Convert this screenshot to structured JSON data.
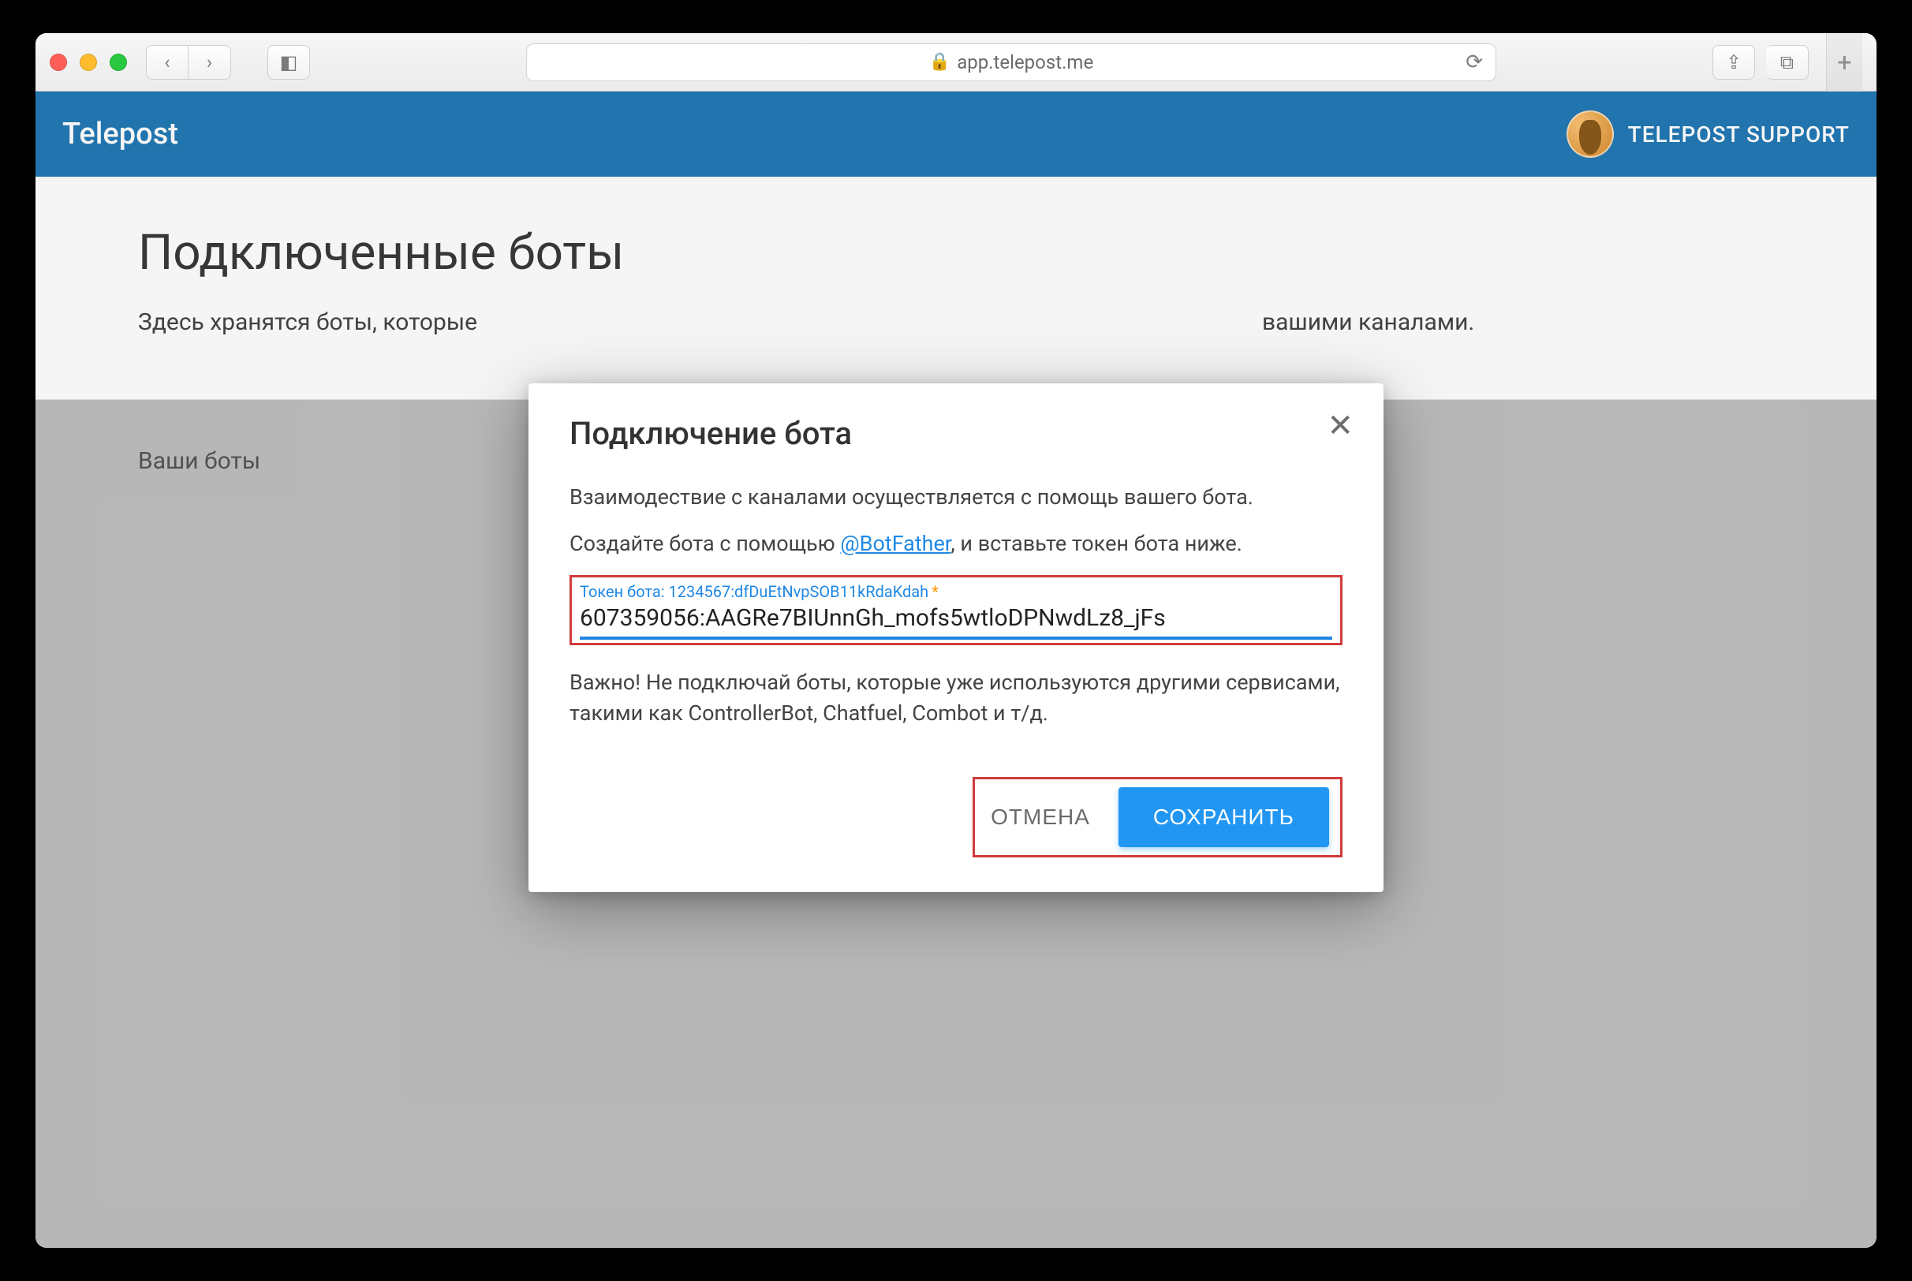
{
  "browser": {
    "url_display": "app.telepost.me",
    "lock_glyph": "🔒",
    "reload_glyph": "⟳",
    "back_glyph": "‹",
    "forward_glyph": "›",
    "sidebar_glyph": "◧",
    "share_glyph": "⇪",
    "tabs_glyph": "⧉",
    "plus_glyph": "+"
  },
  "header": {
    "brand": "Telepost",
    "support_label": "TELEPOST SUPPORT"
  },
  "page": {
    "title": "Подключенные боты",
    "subtitle_visible_left": "Здесь хранятся боты, которые ",
    "subtitle_visible_right": " вашими каналами.",
    "section_label": "Ваши боты"
  },
  "modal": {
    "title": "Подключение бота",
    "close_glyph": "✕",
    "line1": "Взаимодествие с каналами осуществляется с помощь вашего бота.",
    "line2_prefix": "Создайте бота с помощью ",
    "line2_link": "@BotFather",
    "line2_suffix": ", и вставьте токен бота ниже.",
    "field_label": "Токен бота: 1234567:dfDuEtNvpSOB11kRdaKdah",
    "required_mark": "*",
    "token_value": "607359056:AAGRe7BIUnnGh_mofs5wtloDPNwdLz8_jFs",
    "warning": "Важно! Не подключай боты, которые уже используются другими сервисами, такими как ControllerBot, Chatfuel, Combot и т/д.",
    "cancel_label": "ОТМЕНА",
    "save_label": "СОХРАНИТЬ"
  }
}
